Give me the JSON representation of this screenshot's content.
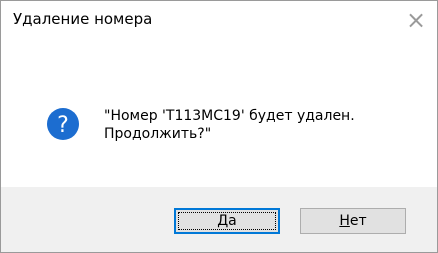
{
  "dialog": {
    "title": "Удаление номера",
    "close_label": "×",
    "icon": "question-icon",
    "message_line1": "\"Номер 'Т113МС19' будет удален.",
    "message_line2": "Продолжить?\""
  },
  "buttons": {
    "yes": {
      "accel": "Д",
      "rest": "а"
    },
    "no": {
      "accel": "Н",
      "rest": "ет"
    }
  },
  "colors": {
    "icon_blue": "#1c6dd0",
    "footer_bg": "#f0f0f0",
    "default_button_border": "#0078d7"
  }
}
